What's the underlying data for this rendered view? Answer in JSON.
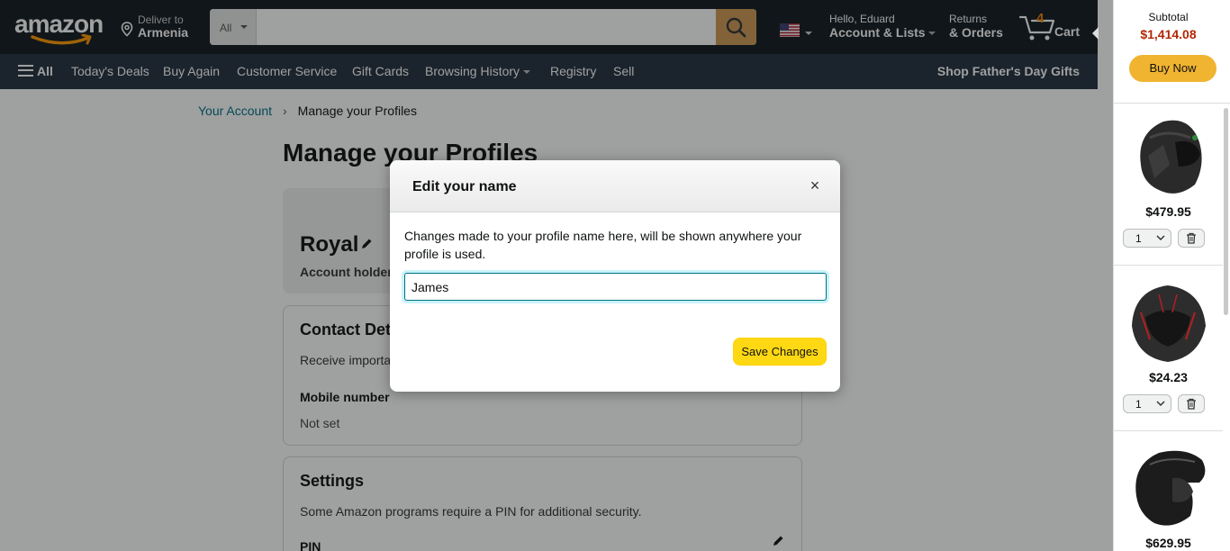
{
  "header": {
    "logo": "amazon",
    "deliver_to_label": "Deliver to",
    "deliver_to_location": "Armenia",
    "search_category": "All",
    "search_placeholder": "",
    "greeting": "Hello, Eduard",
    "account_label": "Account & Lists",
    "returns_label": "Returns",
    "orders_label": "& Orders",
    "cart_count": "4",
    "cart_label": "Cart"
  },
  "nav": {
    "all_label": "All",
    "items": [
      "Today's Deals",
      "Buy Again",
      "Customer Service",
      "Gift Cards",
      "Browsing History",
      "Registry",
      "Sell"
    ],
    "promo": "Shop Father's Day Gifts"
  },
  "breadcrumb": {
    "parent": "Your Account",
    "separator": "›",
    "current": "Manage your Profiles"
  },
  "page": {
    "title": "Manage your Profiles",
    "profile_name": "Royal",
    "profile_role": "Account holder",
    "contact_title": "Contact Det",
    "contact_desc": "Receive importa",
    "mobile_label": "Mobile number",
    "mobile_value": "Not set",
    "settings_title": "Settings",
    "settings_desc": "Some Amazon programs require a PIN for additional security.",
    "pin_label": "PIN"
  },
  "modal": {
    "title": "Edit your name",
    "close_label": "×",
    "description": "Changes made to your profile name here, will be shown anywhere your profile is used.",
    "input_value": "James",
    "save_label": "Save Changes"
  },
  "cart_panel": {
    "subtotal_label": "Subtotal",
    "subtotal_value": "$1,414.08",
    "buy_now_label": "Buy Now",
    "items": [
      {
        "price": "$479.95",
        "qty": "1"
      },
      {
        "price": "$24.23",
        "qty": "1"
      },
      {
        "price": "$629.95",
        "qty": ""
      }
    ]
  },
  "colors": {
    "header_bg": "#131921",
    "subnav_bg": "#232f3e",
    "link": "#007185",
    "price_red": "#b12704",
    "save_button": "#ffd814",
    "buy_now": "#f0b431",
    "cart_count": "#f08804"
  }
}
